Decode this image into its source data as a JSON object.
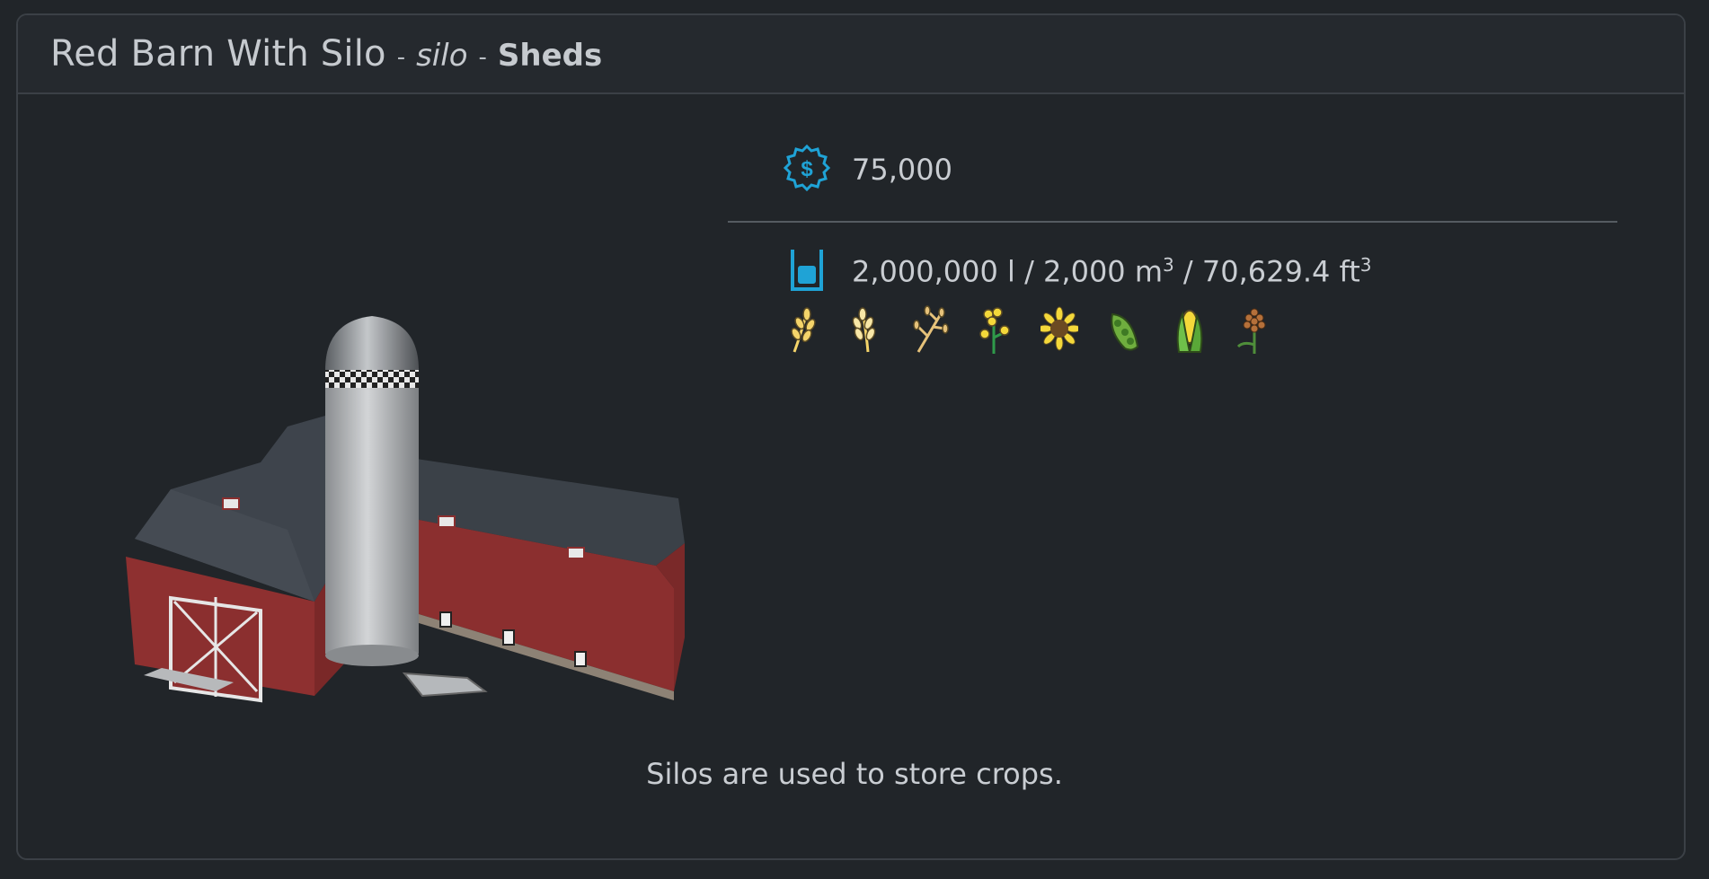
{
  "header": {
    "name": "Red Barn With Silo",
    "separator": "-",
    "type": "silo",
    "category": "Sheds"
  },
  "price": {
    "icon": "price-gear-icon",
    "value": "75,000"
  },
  "capacity": {
    "icon": "storage-icon",
    "liters": "2,000,000 l",
    "m3": "2,000 m",
    "ft3": "70,629.4 ft",
    "sep": "/",
    "exp": "3"
  },
  "fruits": [
    {
      "name": "wheat-icon"
    },
    {
      "name": "barley-icon"
    },
    {
      "name": "oat-icon"
    },
    {
      "name": "canola-icon"
    },
    {
      "name": "sunflower-icon"
    },
    {
      "name": "soybean-icon"
    },
    {
      "name": "maize-icon"
    },
    {
      "name": "sorghum-icon"
    }
  ],
  "description": "Silos are used to store crops.",
  "colors": {
    "accent": "#1fa3d6",
    "fruit_fill": "#f4d46a",
    "background": "#212529"
  }
}
